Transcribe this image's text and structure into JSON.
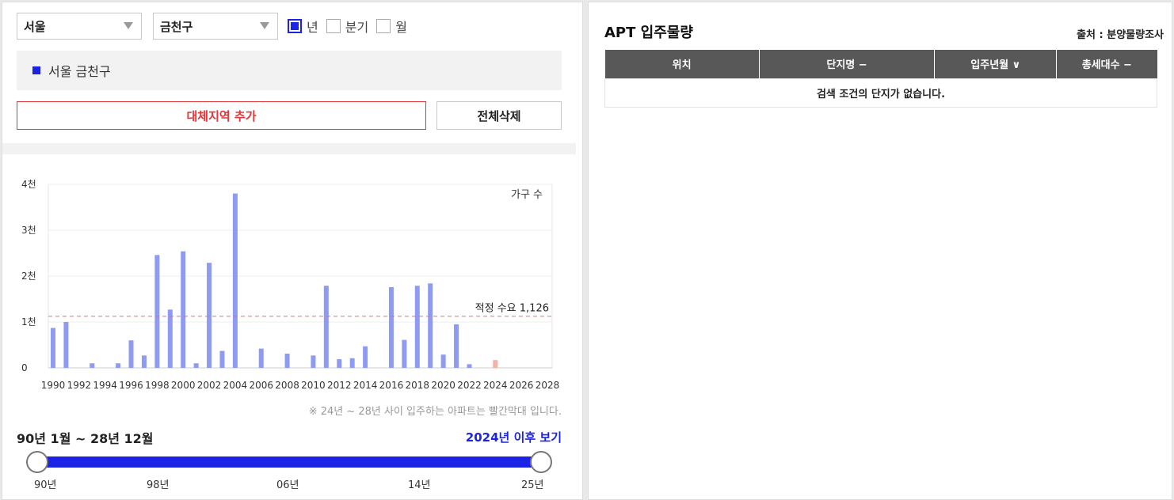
{
  "filters": {
    "city": "서울",
    "district": "금천구",
    "period_options": [
      {
        "label": "년",
        "checked": true
      },
      {
        "label": "분기",
        "checked": false
      },
      {
        "label": "월",
        "checked": false
      }
    ]
  },
  "selected_region": "서울 금천구",
  "buttons": {
    "add_region": "대체지역 추가",
    "delete_all": "전체삭제"
  },
  "note": "※ 24년 ~ 28년 사이 입주하는 아파트는 빨간막대 입니다.",
  "range": {
    "label": "90년 1월 ~ 28년 12월",
    "after_link": "2024년 이후 보기"
  },
  "slider": {
    "ticks": [
      "90년",
      "98년",
      "06년",
      "14년",
      "25년"
    ],
    "start_value": "90년",
    "end_value": "25년"
  },
  "colors": {
    "accent": "#1a23e6",
    "bar": "#8f9af3",
    "future_bar": "#f4b3a5",
    "demand_line": "#ef6d6d",
    "add_button": "#e2373a"
  },
  "chart_data": {
    "type": "bar",
    "series_label": "가구 수",
    "demand_label": "적정 수요 1,126",
    "demand_value": 1126,
    "ylim": [
      0,
      4000
    ],
    "y_ticks": [
      {
        "v": 0,
        "label": "0"
      },
      {
        "v": 1000,
        "label": "1천"
      },
      {
        "v": 2000,
        "label": "2천"
      },
      {
        "v": 3000,
        "label": "3천"
      },
      {
        "v": 4000,
        "label": "4천"
      }
    ],
    "x_range": [
      1990,
      2028
    ],
    "x_ticks": [
      1990,
      1992,
      1994,
      1996,
      1998,
      2000,
      2002,
      2004,
      2006,
      2008,
      2010,
      2012,
      2014,
      2016,
      2018,
      2020,
      2022,
      2024,
      2026,
      2028
    ],
    "bars": [
      {
        "year": 1990,
        "value": 870
      },
      {
        "year": 1991,
        "value": 1000
      },
      {
        "year": 1993,
        "value": 100
      },
      {
        "year": 1995,
        "value": 100
      },
      {
        "year": 1996,
        "value": 600
      },
      {
        "year": 1997,
        "value": 270
      },
      {
        "year": 1998,
        "value": 2460
      },
      {
        "year": 1999,
        "value": 1270
      },
      {
        "year": 2000,
        "value": 2540
      },
      {
        "year": 2001,
        "value": 100
      },
      {
        "year": 2002,
        "value": 2290
      },
      {
        "year": 2003,
        "value": 370
      },
      {
        "year": 2004,
        "value": 3800
      },
      {
        "year": 2006,
        "value": 420
      },
      {
        "year": 2008,
        "value": 310
      },
      {
        "year": 2010,
        "value": 270
      },
      {
        "year": 2011,
        "value": 1790
      },
      {
        "year": 2012,
        "value": 190
      },
      {
        "year": 2013,
        "value": 210
      },
      {
        "year": 2014,
        "value": 470
      },
      {
        "year": 2016,
        "value": 1760
      },
      {
        "year": 2017,
        "value": 610
      },
      {
        "year": 2018,
        "value": 1790
      },
      {
        "year": 2019,
        "value": 1840
      },
      {
        "year": 2020,
        "value": 290
      },
      {
        "year": 2021,
        "value": 950
      },
      {
        "year": 2022,
        "value": 80
      },
      {
        "year": 2024,
        "value": 170,
        "future": true
      }
    ]
  },
  "right": {
    "title": "APT 입주물량",
    "source": "출처 : 분양물량조사",
    "columns": [
      "위치",
      "단지명 −",
      "입주년월 ∨",
      "총세대수 −"
    ],
    "empty_message": "검색 조건의 단지가 없습니다."
  }
}
